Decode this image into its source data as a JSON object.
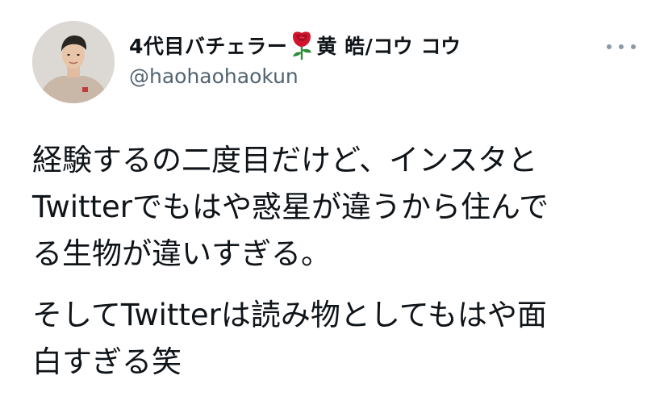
{
  "tweet": {
    "author": {
      "display_name_prefix": "4代目バチェラー",
      "display_name_suffix": "黄 皓/コウ コウ",
      "emoji": "rose",
      "handle": "@haohaohaokun",
      "avatar": "profile-photo"
    },
    "more_icon": "more-horizontal-icon",
    "paragraphs": [
      "経験するの二度目だけど、インスタと\nTwitterでもはや惑星が違うから住んで\nる生物が違いすぎる。",
      "そしてTwitterは読み物としてもはや面\n白すぎる笑"
    ]
  },
  "colors": {
    "text_primary": "#0f1419",
    "text_secondary": "#536471",
    "rose_red": "#d0142c",
    "rose_leaf": "#2e8b3a"
  }
}
